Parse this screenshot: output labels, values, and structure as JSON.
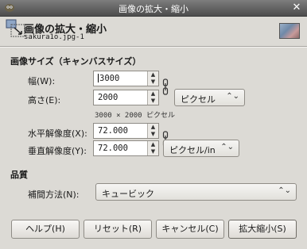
{
  "window": {
    "title": "画像の拡大・縮小"
  },
  "header": {
    "title": "画像の拡大・縮小",
    "subtitle": "sakura1o.jpg-1"
  },
  "image_size": {
    "section_label": "画像サイズ（キャンバスサイズ）",
    "width_label": "幅(W):",
    "width_value": "3000",
    "height_label": "高さ(E):",
    "height_value": "2000",
    "unit": "ピクセル",
    "dimensions_info": "3000 × 2000 ピクセル"
  },
  "resolution": {
    "x_label": "水平解像度(X):",
    "x_value": "72.000",
    "y_label": "垂直解像度(Y):",
    "y_value": "72.000",
    "unit": "ピクセル/in"
  },
  "quality": {
    "section_label": "品質",
    "method_label": "補間方法(N):",
    "method_value": "キュービック"
  },
  "buttons": {
    "help": "ヘルプ(H)",
    "reset": "リセット(R)",
    "cancel": "キャンセル(C)",
    "scale": "拡大縮小(S)"
  }
}
